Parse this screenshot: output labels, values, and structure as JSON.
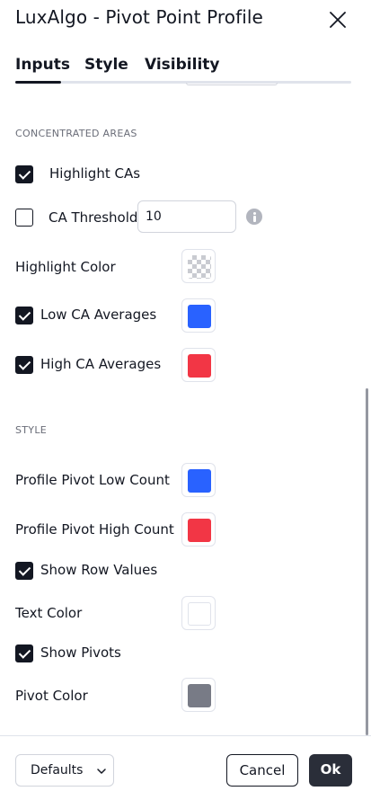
{
  "dialog": {
    "title": "LuxAlgo - Pivot Point Profile",
    "close_icon": "close-icon"
  },
  "tabs": [
    {
      "label": "Inputs",
      "active": true
    },
    {
      "label": "Style",
      "active": false
    },
    {
      "label": "Visibility",
      "active": false
    }
  ],
  "concentrated_areas": {
    "section_title": "CONCENTRATED AREAS",
    "highlight_cas": {
      "label": "Highlight CAs",
      "checked": true
    },
    "ca_threshold": {
      "label": "CA Threshold",
      "checked": false,
      "value": "10",
      "info_icon": "info-icon"
    },
    "highlight_color": {
      "label": "Highlight Color",
      "color": "transparent"
    },
    "low_ca_averages": {
      "label": "Low CA Averages",
      "checked": true,
      "color": "#2962ff"
    },
    "high_ca_averages": {
      "label": "High CA Averages",
      "checked": true,
      "color": "#f23645"
    }
  },
  "style": {
    "section_title": "STYLE",
    "profile_pivot_low_count": {
      "label": "Profile Pivot Low Count",
      "color": "#2962ff"
    },
    "profile_pivot_high_count": {
      "label": "Profile Pivot High Count",
      "color": "#f23645"
    },
    "show_row_values": {
      "label": "Show Row Values",
      "checked": true
    },
    "text_color": {
      "label": "Text Color",
      "color": "#ffffff"
    },
    "show_pivots": {
      "label": "Show Pivots",
      "checked": true
    },
    "pivot_color": {
      "label": "Pivot Color",
      "color": "#787b86"
    }
  },
  "footer": {
    "defaults_label": "Defaults",
    "defaults_icon": "chevron-down-icon",
    "cancel_label": "Cancel",
    "ok_label": "Ok"
  }
}
